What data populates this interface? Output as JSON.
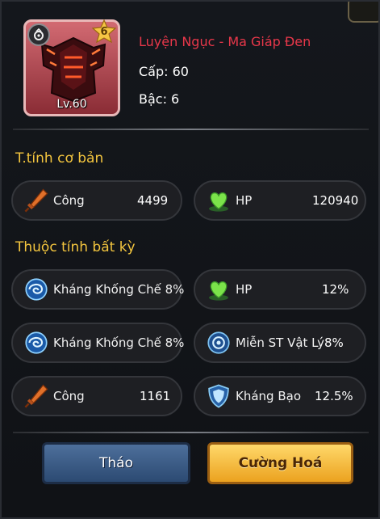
{
  "item": {
    "name": "Luyện Ngục - Ma Giáp Đen",
    "level_label": "Cấp: 60",
    "tier_label": "Bậc: 6",
    "card_level": "Lv.60",
    "stars": "6"
  },
  "base_section": {
    "title": "T.tính cơ bản",
    "stats": [
      {
        "label": "Công",
        "value": "4499",
        "icon": "sword-icon"
      },
      {
        "label": "HP",
        "value": "120940",
        "icon": "heart-icon"
      }
    ]
  },
  "random_section": {
    "title": "Thuộc tính bất kỳ",
    "stats": [
      {
        "label": "Kháng Khống Chế 8%",
        "value": "",
        "icon": "control-resist-icon"
      },
      {
        "label": "HP",
        "value": "12%",
        "icon": "heart-icon"
      },
      {
        "label": "Kháng Khống Chế 8%",
        "value": "",
        "icon": "control-resist-icon"
      },
      {
        "label": "Miễn ST Vật Lý",
        "value": "8%",
        "icon": "physical-shield-icon"
      },
      {
        "label": "Công",
        "value": "1161",
        "icon": "sword-icon"
      },
      {
        "label": "Kháng Bạo",
        "value": "12.5%",
        "icon": "crit-resist-shield-icon"
      }
    ]
  },
  "buttons": {
    "unequip": "Tháo",
    "upgrade": "Cường Hoá"
  },
  "colors": {
    "item_name": "#e8374a",
    "section_title": "#f3c53e",
    "unequip_button": "#3d5f8c",
    "upgrade_button": "#f5bd3a"
  }
}
